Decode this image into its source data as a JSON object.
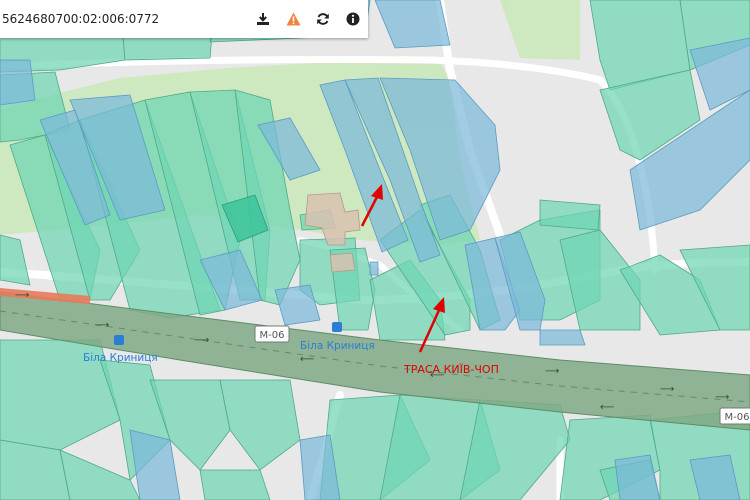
{
  "search": {
    "cadastral_number": "5624680700:02:006:0772",
    "buttons": [
      {
        "name": "download",
        "icon": "download-icon"
      },
      {
        "name": "warning",
        "icon": "warning-icon"
      },
      {
        "name": "refresh",
        "icon": "refresh-icon"
      },
      {
        "name": "info",
        "icon": "info-icon"
      }
    ]
  },
  "map": {
    "road_shields": [
      "M-06",
      "M-06"
    ],
    "place_labels": [
      "Біла Криниця",
      "Біла Криниця"
    ],
    "annotation": "ТРАСА КИЇВ-ЧОП",
    "colors": {
      "parcel_green": "#6fd6b4",
      "parcel_blue": "#7bb8d9",
      "parcel_outline": "#5aa88c",
      "highway_band": "#7fa985",
      "highway_edge": "#e87a5a",
      "park": "#c9e7b8",
      "building": "#d8c1b0",
      "label_blue": "#2a7fd4",
      "annotation_red": "#e00000",
      "background": "#e8e8e8"
    }
  }
}
